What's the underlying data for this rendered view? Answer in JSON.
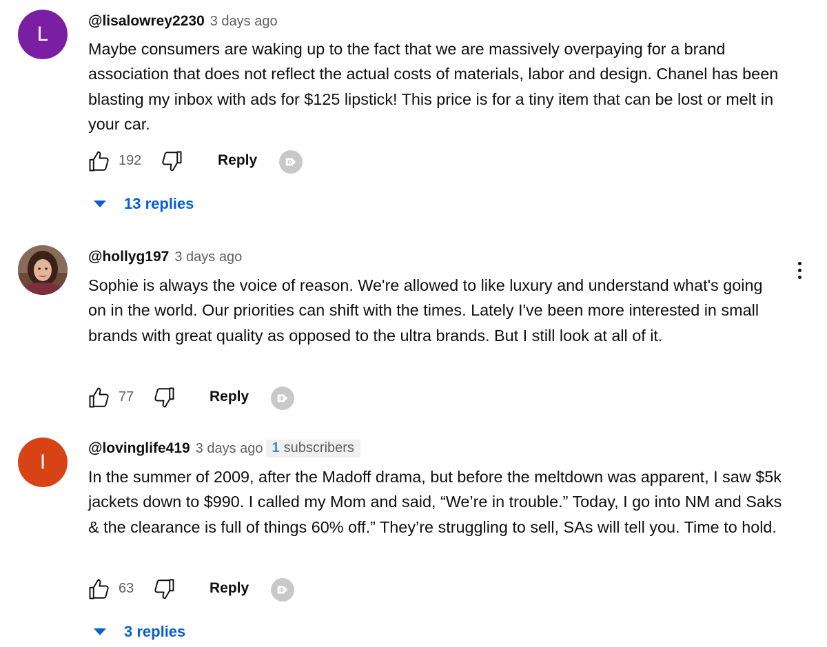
{
  "comments": [
    {
      "author": "@lisalowrey2230",
      "time": "3 days ago",
      "avatar_letter": "L",
      "avatar_color": "#7b1fa2",
      "text": "Maybe consumers are waking up to the fact that we are massively overpaying for a brand association that does not reflect the actual costs of materials, labor and design. Chanel has been blasting my inbox with ads for $125 lipstick!  This price is for a tiny item that can be lost or melt in your car.",
      "likes": "192",
      "reply_label": "Reply",
      "replies_label": "13 replies"
    },
    {
      "author": "@hollyg197",
      "time": "3 days ago",
      "avatar_type": "photo",
      "text": "Sophie is always the voice of reason. We're allowed to like luxury and understand what's going on in the world. Our priorities can shift with the times. Lately I've been more interested in small brands with great quality as opposed to the ultra brands. But I still look at all of it.",
      "likes": "77",
      "reply_label": "Reply"
    },
    {
      "author": "@lovinglife419",
      "time": "3 days ago",
      "avatar_letter": "I",
      "avatar_color": "#d84315",
      "subscriber_count": "1",
      "subscriber_label": "subscribers",
      "text": "In the summer of 2009, after the Madoff drama, but before the meltdown was apparent, I saw $5k jackets down to $990. I called my Mom and said, “We’re in trouble.” Today, I go into NM and Saks & the clearance is full of things 60% off.” They’re struggling to sell, SAs will tell you. Time to hold.",
      "likes": "63",
      "reply_label": "Reply",
      "replies_label": "3 replies"
    }
  ],
  "icons": {
    "like": "thumbs-up-icon",
    "dislike": "thumbs-down-icon",
    "flag": "flag-badge-icon",
    "more": "more-vert-icon"
  },
  "colors": {
    "link_blue": "#065fd4",
    "secondary_text": "#606060",
    "badge_grey": "#c8c8c8"
  }
}
